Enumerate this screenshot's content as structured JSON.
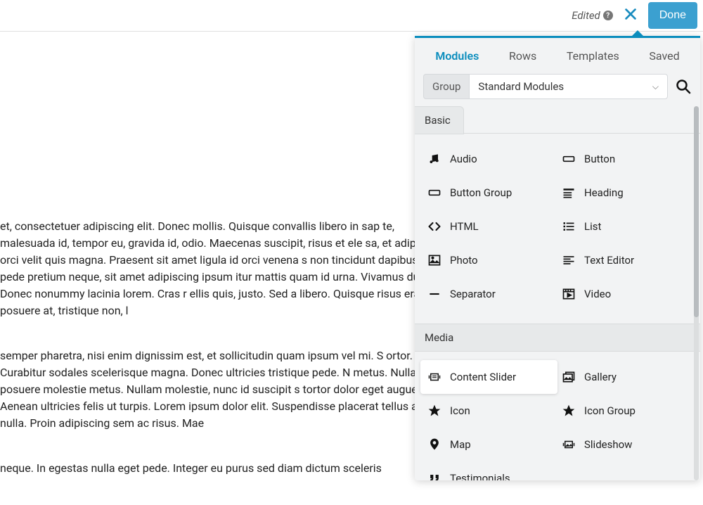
{
  "header": {
    "edited_label": "Edited",
    "done_label": "Done"
  },
  "content": {
    "p1": "et, consectetuer adipiscing elit. Donec mollis. Quisque convallis libero in sap te, malesuada id, tempor eu, gravida id, odio. Maecenas suscipit, risus et ele sa, et adipiscing orci velit quis magna. Praesent sit amet ligula id orci venena s non tincidunt dapibus, orci pede pretium neque, sit amet adipiscing ipsum itur mattis quam id urna. Vivamus dui. Donec nonummy lacinia lorem. Cras r ellis quis, justo. Sed a libero. Quisque risus erat, posuere at, tristique non, l",
    "p2": "semper pharetra, nisi enim dignissim est, et sollicitudin quam ipsum vel mi. S ortor. Curabitur sodales scelerisque magna. Donec ultricies tristique pede. N metus. Nullam posuere molestie metus. Nullam molestie, nunc id suscipit s tortor dolor eget augue. Aenean ultricies felis ut turpis. Lorem ipsum dolor elit. Suspendisse placerat tellus ac nulla. Proin adipiscing sem ac risus. Mae",
    "p3": "neque. In egestas nulla eget pede. Integer eu purus sed diam dictum sceleris"
  },
  "panel": {
    "tabs": {
      "modules": "Modules",
      "rows": "Rows",
      "templates": "Templates",
      "saved": "Saved"
    },
    "group_label": "Group",
    "group_value": "Standard Modules",
    "sections": {
      "basic": {
        "title": "Basic",
        "items": [
          {
            "name": "audio",
            "label": "Audio"
          },
          {
            "name": "button",
            "label": "Button"
          },
          {
            "name": "button-group",
            "label": "Button Group"
          },
          {
            "name": "heading",
            "label": "Heading"
          },
          {
            "name": "html",
            "label": "HTML"
          },
          {
            "name": "list",
            "label": "List"
          },
          {
            "name": "photo",
            "label": "Photo"
          },
          {
            "name": "text-editor",
            "label": "Text Editor"
          },
          {
            "name": "separator",
            "label": "Separator"
          },
          {
            "name": "video",
            "label": "Video"
          }
        ]
      },
      "media": {
        "title": "Media",
        "items": [
          {
            "name": "content-slider",
            "label": "Content Slider"
          },
          {
            "name": "gallery",
            "label": "Gallery"
          },
          {
            "name": "icon",
            "label": "Icon"
          },
          {
            "name": "icon-group",
            "label": "Icon Group"
          },
          {
            "name": "map",
            "label": "Map"
          },
          {
            "name": "slideshow",
            "label": "Slideshow"
          },
          {
            "name": "testimonials",
            "label": "Testimonials"
          }
        ]
      }
    }
  }
}
